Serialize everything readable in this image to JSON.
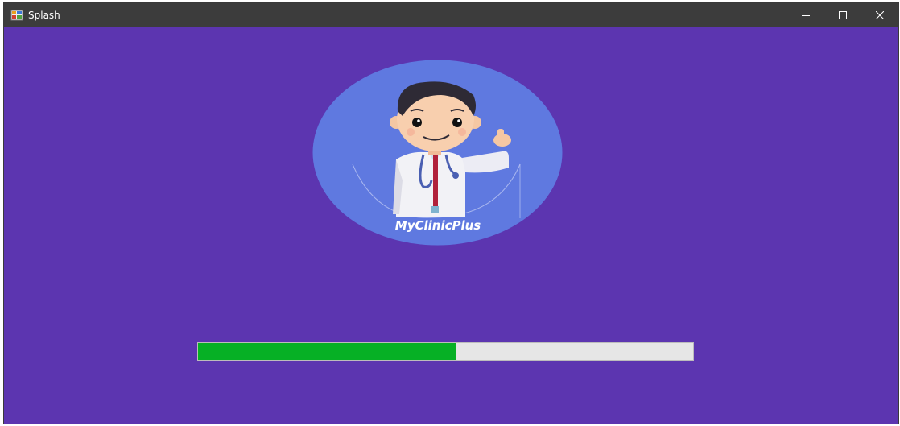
{
  "window": {
    "title": "Splash",
    "icon": "app-window-icon",
    "controls": {
      "minimize": "minimize-icon",
      "maximize": "maximize-icon",
      "close": "close-icon"
    }
  },
  "logo": {
    "text": "MyClinicPlus",
    "image": "doctor-mascot-icon"
  },
  "progress": {
    "value_fraction": 0.52
  },
  "colors": {
    "background": "#5c35b0",
    "titlebar": "#3c3c3c",
    "logo_circle": "#5f79e0",
    "progress_fill": "#06b025",
    "progress_track": "#e6e6e6"
  }
}
